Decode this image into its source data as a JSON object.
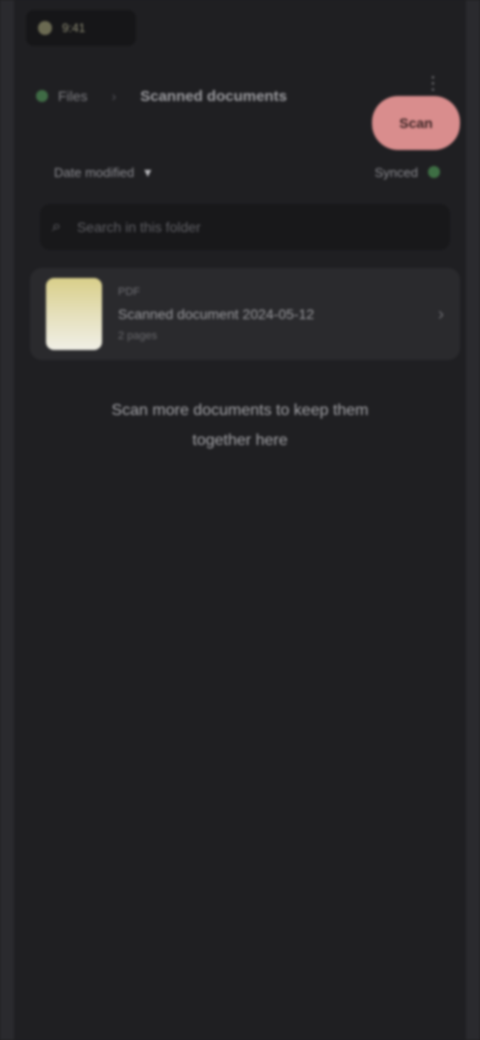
{
  "status_bar": {
    "time": "9:41"
  },
  "header": {
    "crumb": "Files",
    "separator": "›",
    "title": "Scanned documents"
  },
  "actions": {
    "primary_label": "Scan",
    "corner_icon": "more-icon"
  },
  "filter": {
    "sort_label": "Date modified",
    "sort_chevron": "▾",
    "status_label": "Synced"
  },
  "search": {
    "placeholder": "Search in this folder"
  },
  "items": [
    {
      "subtitle": "PDF",
      "title": "Scanned document 2024-05-12",
      "meta": "2 pages"
    }
  ],
  "empty_message": "Scan more documents to keep them together here",
  "colors": {
    "background": "#1f1f22",
    "accent": "#d98d8d",
    "status_green": "#3e6e44"
  }
}
